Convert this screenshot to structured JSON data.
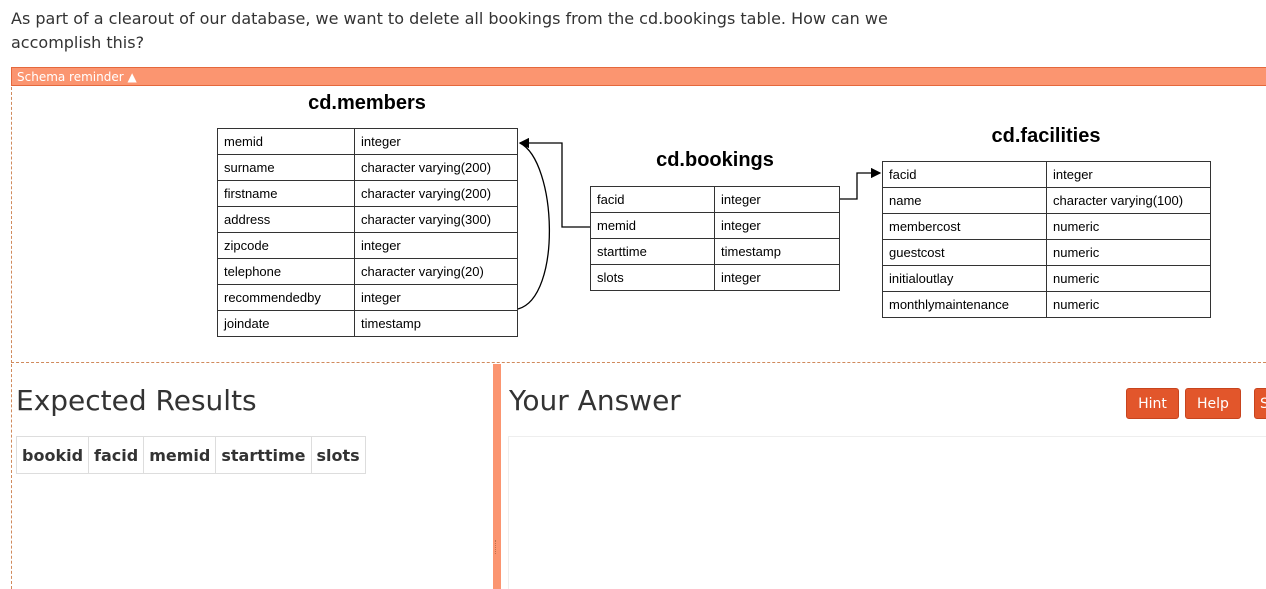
{
  "question": "As part of a clearout of our database, we want to delete all bookings from the cd.bookings table. How can we accomplish this?",
  "schema_reminder": {
    "label": "Schema reminder ▲"
  },
  "schema": {
    "members": {
      "title": "cd.members",
      "rows": [
        {
          "col": "memid",
          "type": "integer"
        },
        {
          "col": "surname",
          "type": "character varying(200)"
        },
        {
          "col": "firstname",
          "type": "character varying(200)"
        },
        {
          "col": "address",
          "type": "character varying(300)"
        },
        {
          "col": "zipcode",
          "type": "integer"
        },
        {
          "col": "telephone",
          "type": "character varying(20)"
        },
        {
          "col": "recommendedby",
          "type": "integer"
        },
        {
          "col": "joindate",
          "type": "timestamp"
        }
      ]
    },
    "bookings": {
      "title": "cd.bookings",
      "rows": [
        {
          "col": "facid",
          "type": "integer"
        },
        {
          "col": "memid",
          "type": "integer"
        },
        {
          "col": "starttime",
          "type": "timestamp"
        },
        {
          "col": "slots",
          "type": "integer"
        }
      ]
    },
    "facilities": {
      "title": "cd.facilities",
      "rows": [
        {
          "col": "facid",
          "type": "integer"
        },
        {
          "col": "name",
          "type": "character varying(100)"
        },
        {
          "col": "membercost",
          "type": "numeric"
        },
        {
          "col": "guestcost",
          "type": "numeric"
        },
        {
          "col": "initialoutlay",
          "type": "numeric"
        },
        {
          "col": "monthlymaintenance",
          "type": "numeric"
        }
      ]
    }
  },
  "expected_results": {
    "heading": "Expected Results",
    "columns": [
      "bookid",
      "facid",
      "memid",
      "starttime",
      "slots"
    ]
  },
  "your_answer": {
    "heading": "Your Answer",
    "buttons": {
      "hint": "Hint",
      "help": "Help",
      "submit_partial": "S"
    }
  },
  "colors": {
    "accent": "#fb9570",
    "button": "#e2562b"
  }
}
